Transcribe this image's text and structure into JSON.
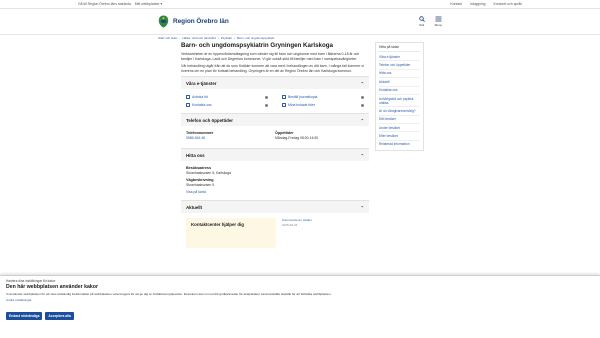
{
  "topstrip": {
    "left": "Gå till Region Örebro läns startsida",
    "left2": "Mitt webbplatser ▾",
    "right": [
      "Kontakt",
      "Inloggning",
      "Kontoret och språk"
    ]
  },
  "header": {
    "logo_text": "Region Örebro län",
    "search_label": "Sök",
    "menu_label": "Meny"
  },
  "breadcrumb": [
    "Start och sidor",
    "Hälsa, vård och tandvård",
    "Psykiatri",
    "Barn- och ungdomspsykiatri"
  ],
  "main": {
    "title": "Barn- och ungdomspsykiatrin Gryningen Karlskoga",
    "intro1": "Verksamheten är en öppenvårdsmottagning som vänder sig till barn och ungdomar med barn i åldrarna 0-18 år och familjer i Karlskoga, Laxå och Degerfors kommuner. Vi gör också stöd till familjer med barn i samspelssvårigheter.",
    "intro2": "Vår behandling utgår från att du som förälder kommer att vara med i behandlingen av ditt barn. I många fall kommer vi överens om en plan för fortsatt behandling. Gryningen är en del av Region Örebro län och Karlskoga kommun."
  },
  "eservices": {
    "heading": "Våra e-tjänster",
    "items": [
      "Avboka tid",
      "Beställ journalkopia",
      "Kontakta oss",
      "Mina bokade tider"
    ]
  },
  "contact": {
    "heading": "Telefon och öppettider",
    "phone_label": "Telefonnummer",
    "phone_value": "0586-466 48",
    "hours_label": "Öppettider",
    "hours_value": "Måndag-Fredag 08:00-16:30"
  },
  "find": {
    "heading": "Hitta oss",
    "visit_label": "Besöksadress",
    "visit_value": "Skranhaaksvaen 5, Karlskoga",
    "directions_label": "Vägbeskrivning",
    "directions_value": "Skranhaaksvaen 5",
    "map_link": "Visa på karta"
  },
  "news": {
    "heading": "Aktuellt",
    "card_title": "Kontaktcenter hjälper dig",
    "side_link": "Kommunicera i staden",
    "side_date": "2025-06-04"
  },
  "sidebar": {
    "title": "Hitta på sidan",
    "items": [
      "Våra e-tjänster",
      "Telefon och öppettider",
      "Hitta oss",
      "Aktuellt",
      "Kontakta oss",
      "Anhörigstöd och psykisk ohälsa",
      "Är du vårdgivare/anhörig?",
      "Ditt besöker",
      "Under besöket",
      "Efter besöket",
      "Relaterad information"
    ]
  },
  "cookie": {
    "small": "Hantera dina inställningar för kakor",
    "title": "Den här webbplatsen använder kakor",
    "text": "Vi använder webbplatsen för att visa nödvändig funktionalitet på webbplatsen vara fungera för att ge dig en förbättrad upplevelse. Dessutom kan vi med ditt godkännande för analyskakor sammanställa statistik för att förbättra webbplatsen.",
    "link": "Ändra inställningar",
    "btn_necessary": "Endast nödvändiga",
    "btn_accept": "Acceptera alla"
  }
}
